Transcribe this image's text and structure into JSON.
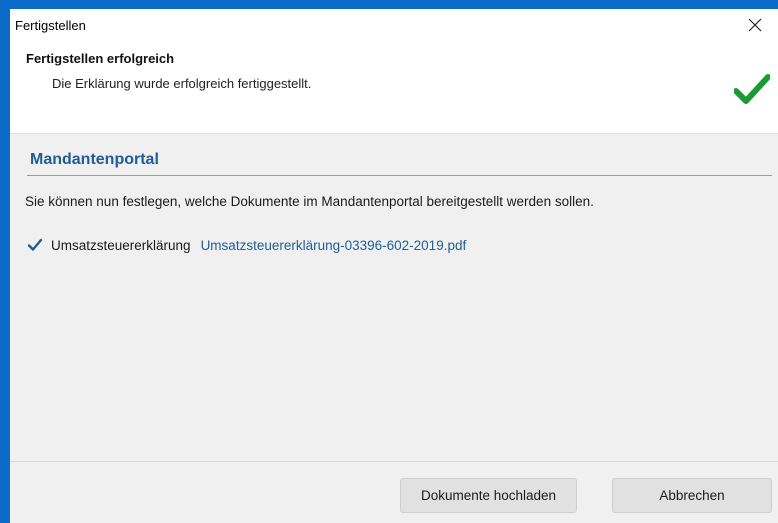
{
  "window": {
    "title": "Fertigstellen",
    "close_icon": "close-icon"
  },
  "status": {
    "title": "Fertigstellen erfolgreich",
    "description": "Die Erklärung wurde erfolgreich fertiggestellt.",
    "icon": "success-check-icon",
    "icon_color": "#1a9a34"
  },
  "portal": {
    "section_title": "Mandantenportal",
    "info": "Sie können nun festlegen, welche Dokumente im Mandantenportal bereitgestellt werden sollen.",
    "documents": [
      {
        "label": "Umsatzsteuererklärung",
        "file": "Umsatzsteuererklärung-03396-602-2019.pdf",
        "checked": true
      }
    ]
  },
  "footer": {
    "upload_label": "Dokumente hochladen",
    "cancel_label": "Abbrechen"
  },
  "colors": {
    "window_border": "#0a6cc8",
    "accent_text": "#1f5d96",
    "checkbox_tick": "#1f5d96"
  }
}
